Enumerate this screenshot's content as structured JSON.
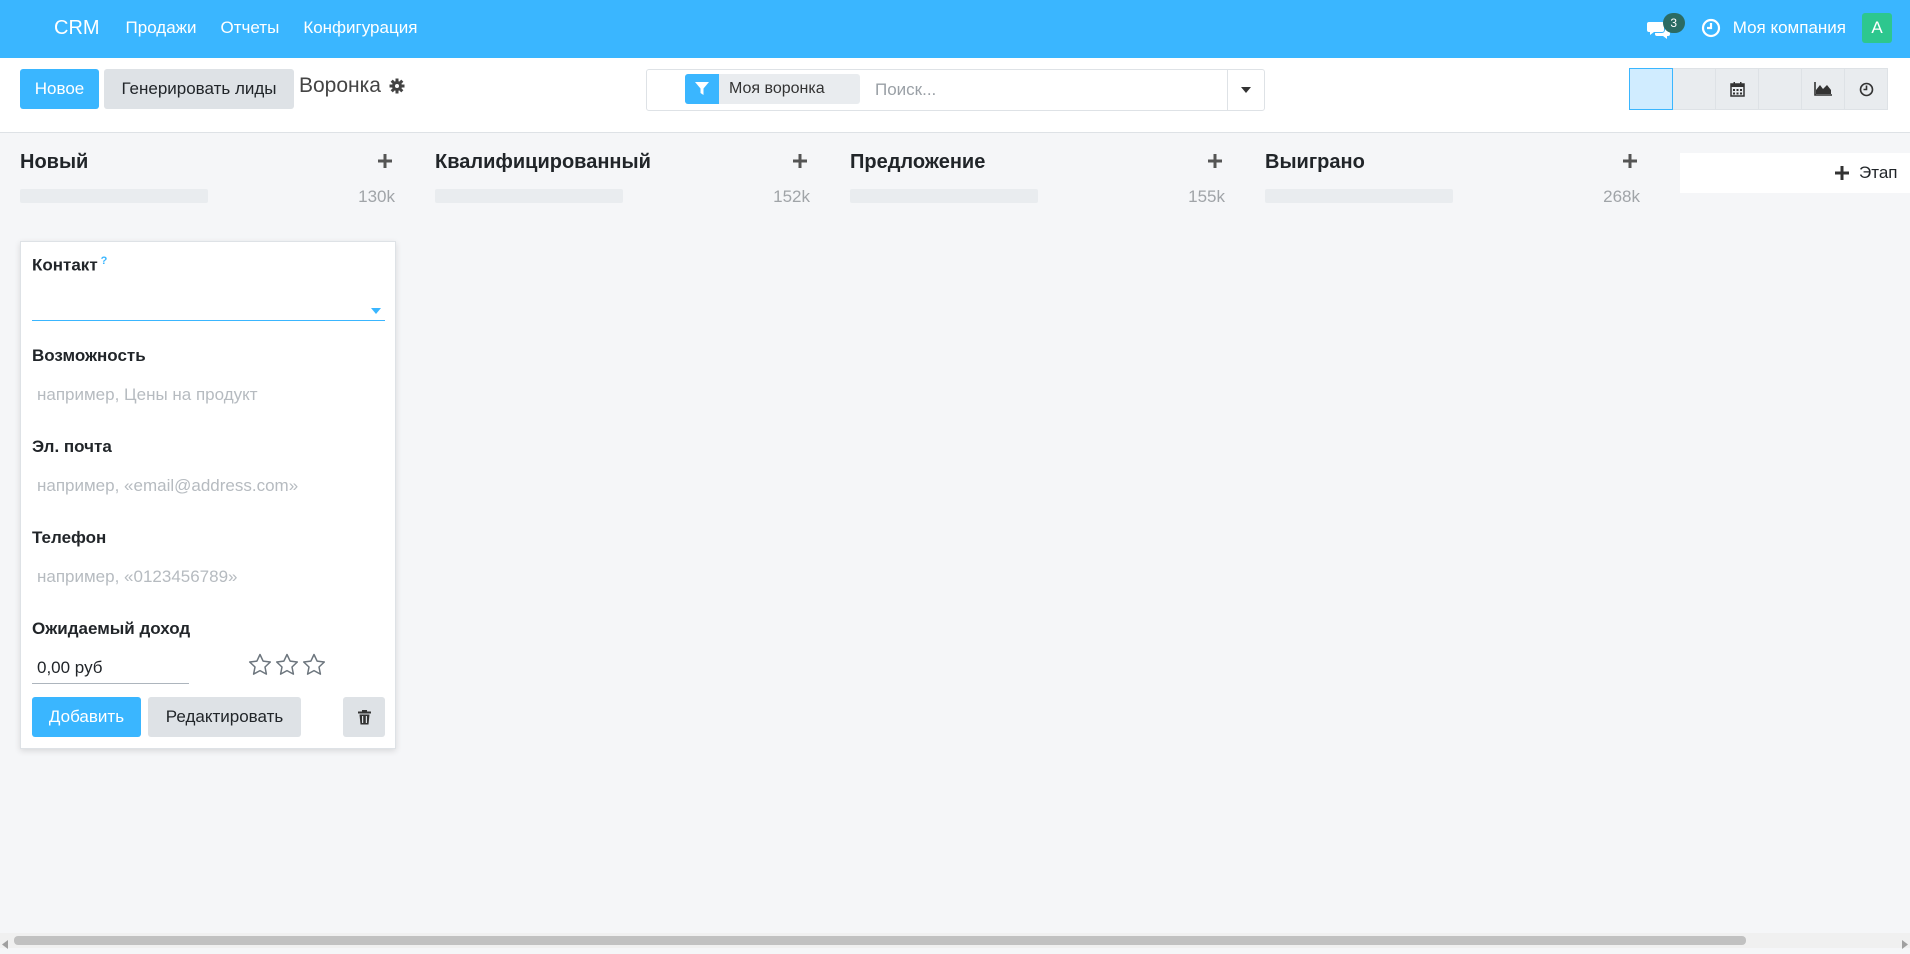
{
  "colors": {
    "primary": "#3ab6ff",
    "navbar": "#3ab6ff",
    "badge": "#2b6b63",
    "avatar": "#2dc78e",
    "background": "#f5f6f8"
  },
  "navbar": {
    "brand": "CRM",
    "menu": [
      "Продажи",
      "Отчеты",
      "Конфигурация"
    ],
    "messages_count": "3",
    "company": "Моя компания",
    "avatar_letter": "A"
  },
  "control": {
    "new_button": "Новое",
    "generate_button": "Генерировать лиды",
    "breadcrumb": "Воронка",
    "search": {
      "facet_label": "Моя воронка",
      "placeholder": "Поиск..."
    },
    "view_switcher": [
      "kanban-view",
      "list-view",
      "calendar-view",
      "pivot-view",
      "graph-view",
      "activity-view"
    ]
  },
  "kanban": {
    "columns": [
      {
        "title": "Новый",
        "sum": "130k",
        "progress": 0
      },
      {
        "title": "Квалифицированный",
        "sum": "152k",
        "progress": 0
      },
      {
        "title": "Предложение",
        "sum": "155k",
        "progress": 0
      },
      {
        "title": "Выиграно",
        "sum": "268k",
        "progress": 0
      }
    ],
    "add_stage_label": "Этап"
  },
  "quick_create": {
    "contact_label": "Контакт",
    "contact_help": "?",
    "contact_value": "",
    "opportunity_label": "Возможность",
    "opportunity_placeholder": "например, Цены на продукт",
    "email_label": "Эл. почта",
    "email_placeholder": "например, «email@address.com»",
    "phone_label": "Телефон",
    "phone_placeholder": "например, «0123456789»",
    "revenue_label": "Ожидаемый доход",
    "revenue_value": "0,00 руб",
    "priority_stars": 0,
    "add_button": "Добавить",
    "edit_button": "Редактировать"
  }
}
